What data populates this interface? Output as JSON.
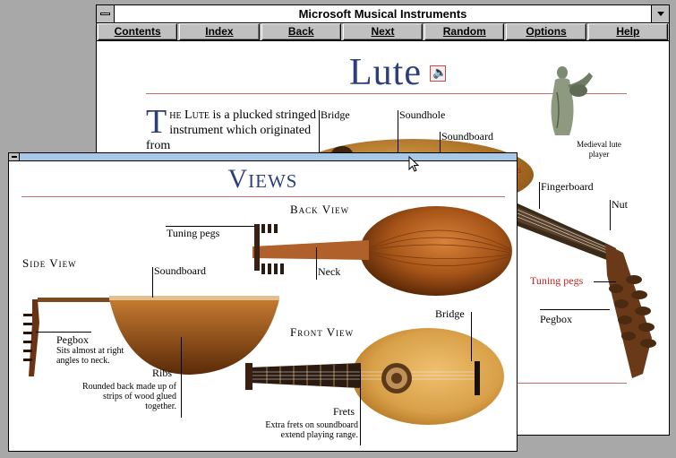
{
  "main_window": {
    "title": "Microsoft Musical Instruments",
    "nav": [
      {
        "label": "Contents"
      },
      {
        "label": "Index"
      },
      {
        "label": "Back"
      },
      {
        "label": "Next"
      },
      {
        "label": "Random"
      },
      {
        "label": "Options"
      },
      {
        "label": "Help"
      }
    ],
    "heading": "Lute",
    "intro": {
      "dropcap": "T",
      "lead": "he Lute",
      "rest": " is a plucked stringed instrument which originated from"
    },
    "callouts": {
      "bridge": "Bridge",
      "soundhole": "Soundhole",
      "soundboard": "Soundboard",
      "fingerboard": "Fingerboard",
      "nut": "Nut",
      "tuning_pegs": "Tuning pegs",
      "pegbox": "Pegbox",
      "partial_red": "s"
    },
    "statue_caption": "Medieval lute player"
  },
  "views_window": {
    "title": "Views",
    "back_view": {
      "heading": "Back View",
      "tuning_pegs": "Tuning pegs",
      "neck": "Neck"
    },
    "side_view": {
      "heading": "Side View",
      "soundboard": "Soundboard",
      "pegbox": "Pegbox",
      "pegbox_note": "Sits almost at right angles to neck.",
      "ribs": "Ribs",
      "ribs_note": "Rounded back made up of strips of wood glued together."
    },
    "front_view": {
      "heading": "Front View",
      "bridge": "Bridge",
      "frets": "Frets",
      "frets_note": "Extra frets on soundboard extend playing range."
    }
  },
  "colors": {
    "title_blue": "#2c3f7c",
    "rule_red": "#c07070",
    "callout_red": "#cc2020",
    "desktop": "#a8a8a8"
  }
}
